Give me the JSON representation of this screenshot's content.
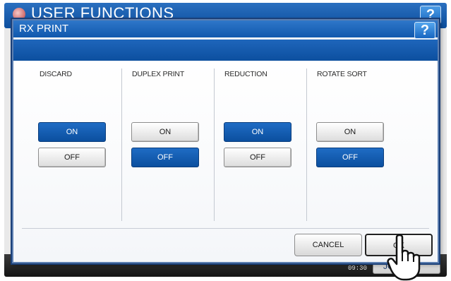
{
  "background": {
    "title": "USER FUNCTIONS",
    "help_label": "?",
    "clock": "09:30",
    "job_label": "JOB"
  },
  "dialog": {
    "title": "RX PRINT",
    "help_label": "?",
    "columns": [
      {
        "label": "DISCARD",
        "on_label": "ON",
        "off_label": "OFF",
        "selected": "ON"
      },
      {
        "label": "DUPLEX PRINT",
        "on_label": "ON",
        "off_label": "OFF",
        "selected": "OFF"
      },
      {
        "label": "REDUCTION",
        "on_label": "ON",
        "off_label": "OFF",
        "selected": "ON"
      },
      {
        "label": "ROTATE SORT",
        "on_label": "ON",
        "off_label": "OFF",
        "selected": "OFF"
      }
    ],
    "cancel_label": "CANCEL",
    "ok_label": "OK"
  },
  "colors": {
    "selected": "#0f58ad",
    "unselected": "#f2f2f2",
    "titlebar": "#1766c0"
  },
  "icons": {
    "pointer": "hand-pointer-icon",
    "logo": "logo-icon"
  }
}
